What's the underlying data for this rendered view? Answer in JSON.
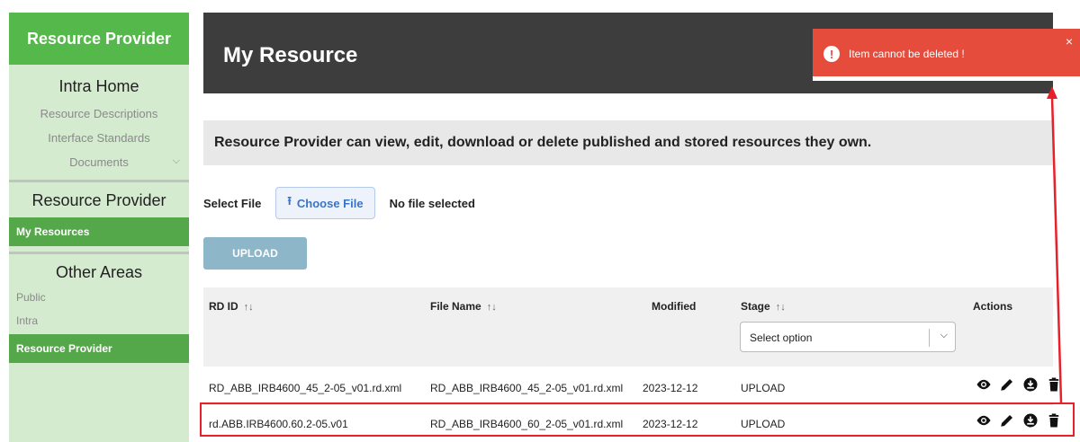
{
  "sidebar": {
    "brand": "Resource Provider",
    "intra_home": "Intra Home",
    "links": [
      "Resource Descriptions",
      "Interface Standards",
      "Documents"
    ],
    "resource_provider_heading": "Resource Provider",
    "my_resources": "My Resources",
    "other_areas_heading": "Other Areas",
    "other_links": [
      "Public",
      "Intra"
    ],
    "active_area": "Resource Provider"
  },
  "header": {
    "title": "My Resource"
  },
  "toast": {
    "message": "Item cannot be deleted !",
    "close": "×",
    "icon": "!"
  },
  "banner": {
    "text": "Resource Provider can view, edit, download or delete published and stored resources they own."
  },
  "file": {
    "label": "Select File",
    "choose_label": "Choose File",
    "status": "No file selected"
  },
  "upload": {
    "label": "UPLOAD"
  },
  "table": {
    "headers": {
      "rdid": "RD ID",
      "filename": "File Name",
      "modified": "Modified",
      "stage": "Stage",
      "actions": "Actions"
    },
    "sort_glyph": "↑↓",
    "stage_placeholder": "Select option",
    "rows": [
      {
        "rdid": "RD_ABB_IRB4600_45_2-05_v01.rd.xml",
        "filename": "RD_ABB_IRB4600_45_2-05_v01.rd.xml",
        "modified": "2023-12-12",
        "stage": "UPLOAD"
      },
      {
        "rdid": "rd.ABB.IRB4600.60.2-05.v01",
        "filename": "RD_ABB_IRB4600_60_2-05_v01.rd.xml",
        "modified": "2023-12-12",
        "stage": "UPLOAD"
      }
    ]
  },
  "colors": {
    "brand_green": "#55b84a",
    "sidebar_bg": "#d4ebd0",
    "toast_red": "#e64c3c",
    "highlight_red": "#e8202a"
  },
  "icons": [
    "eye-icon",
    "pencil-icon",
    "download-icon",
    "trash-icon"
  ]
}
